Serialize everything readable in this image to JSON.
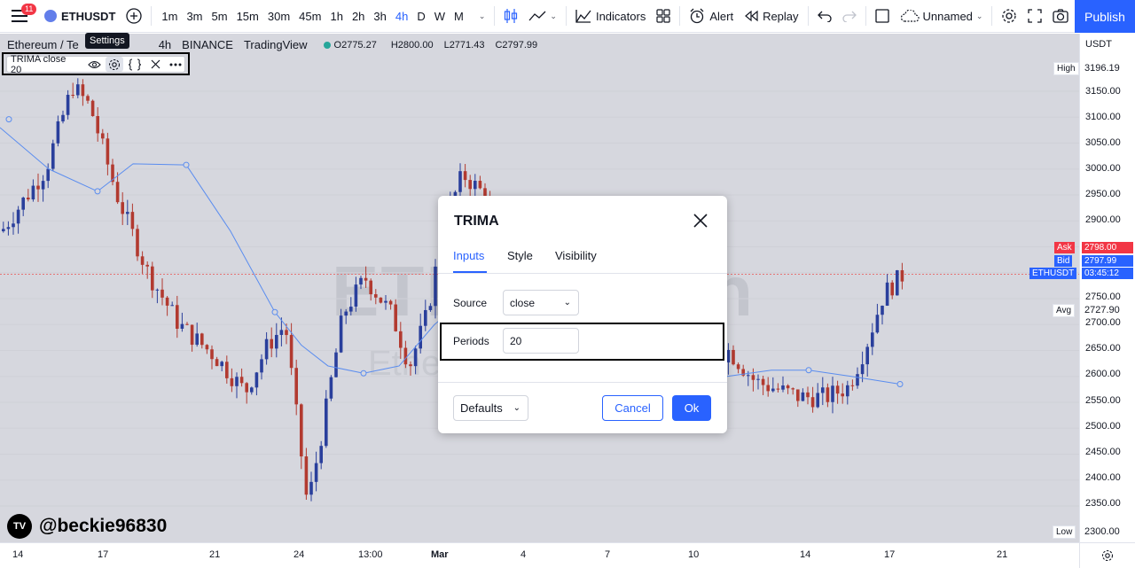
{
  "toolbar": {
    "notifications_count": "11",
    "symbol": "ETHUSDT",
    "timeframes": [
      "1m",
      "3m",
      "5m",
      "15m",
      "30m",
      "45m",
      "1h",
      "2h",
      "3h",
      "4h",
      "D",
      "W",
      "M"
    ],
    "active_timeframe": "4h",
    "indicators_label": "Indicators",
    "alert_label": "Alert",
    "replay_label": "Replay",
    "layout_name": "Unnamed",
    "publish_label": "Publish"
  },
  "legend": {
    "title": "Ethereum / Te",
    "interval": "4h",
    "exchange": "BINANCE",
    "source": "TradingView",
    "open_label": "O",
    "open": "2775.27",
    "high_label": "H",
    "high": "2800.00",
    "low_label": "L",
    "low": "2771.43",
    "close_label": "C",
    "close": "2797.99",
    "indicator_label": "TRIMA close 20",
    "tooltip": "Settings"
  },
  "watermark": {
    "line1": "ETH",
    "line2": "Ethe",
    "tail": "n"
  },
  "credit": "@beckie96830",
  "price_scale": {
    "currency": "USDT",
    "labels": [
      "3150.00",
      "3100.00",
      "3050.00",
      "3000.00",
      "2950.00",
      "2900.00",
      "2750.00",
      "2700.00",
      "2650.00",
      "2600.00",
      "2550.00",
      "2500.00",
      "2450.00",
      "2400.00",
      "2350.00"
    ],
    "high_label": "High",
    "high_value": "3196.19",
    "ask_label": "Ask",
    "ask_value": "2798.00",
    "bid_label": "Bid",
    "bid_value": "2797.99",
    "symbol_tag": "ETHUSDT",
    "symbol_value": "03:45:12",
    "avg_label": "Avg",
    "avg_value": "2727.90",
    "low_label": "Low",
    "low_value": "2300.00"
  },
  "time_scale": {
    "labels": [
      "14",
      "17",
      "21",
      "24",
      "13:00",
      "Mar",
      "4",
      "7",
      "10",
      "14",
      "17",
      "21"
    ]
  },
  "dialog": {
    "title": "TRIMA",
    "tabs": [
      "Inputs",
      "Style",
      "Visibility"
    ],
    "active_tab": "Inputs",
    "source_label": "Source",
    "source_value": "close",
    "periods_label": "Periods",
    "periods_value": "20",
    "defaults_label": "Defaults",
    "cancel_label": "Cancel",
    "ok_label": "Ok"
  },
  "colors": {
    "accent": "#2962ff",
    "bull": "#2a3f9c",
    "bear": "#b23a30",
    "ask": "#f23645",
    "indicator_line": "#5b8def"
  }
}
